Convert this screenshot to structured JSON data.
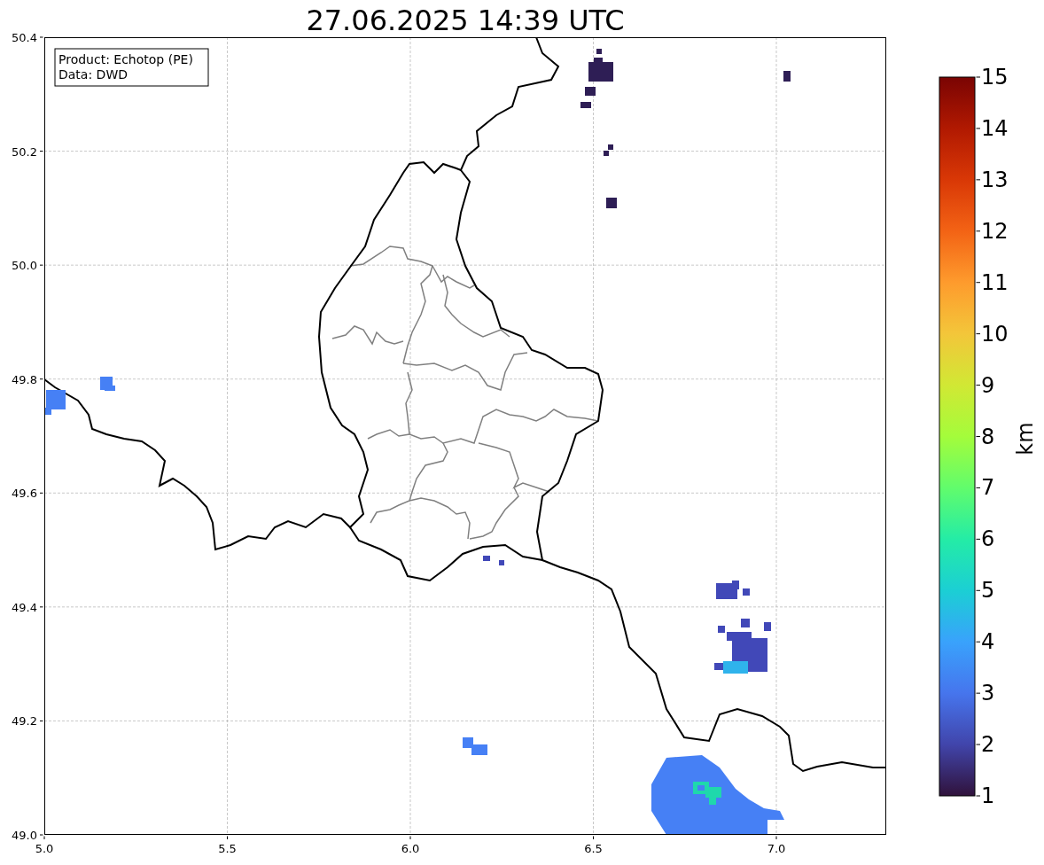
{
  "title": "27.06.2025 14:39 UTC",
  "info_box": {
    "lines": [
      "Product: Echotop (PE)",
      "Data: DWD"
    ]
  },
  "x_axis": {
    "ticks": [
      "5.0",
      "5.5",
      "6.0",
      "6.5",
      "7.0"
    ]
  },
  "y_axis": {
    "ticks": [
      "50.4",
      "50.2",
      "50.0",
      "49.8",
      "49.6",
      "49.4",
      "49.2",
      "49.0"
    ]
  },
  "colorbar": {
    "label": "km",
    "ticks": [
      "15",
      "14",
      "13",
      "12",
      "11",
      "10",
      "9",
      "8",
      "7",
      "6",
      "5",
      "4",
      "3",
      "2",
      "1"
    ]
  }
}
